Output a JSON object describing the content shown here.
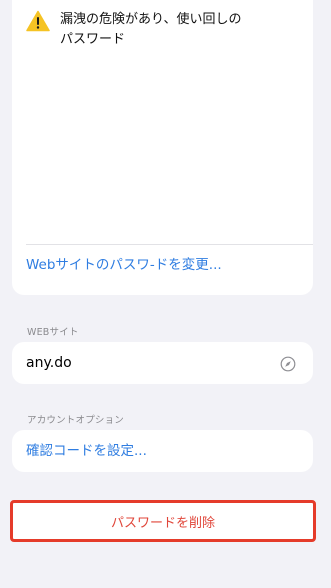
{
  "warning": {
    "line1": "漏洩の危険があり、使い回しの",
    "line2": "パスワード",
    "icon": "warning-triangle-icon",
    "icon_color": "#f5c324"
  },
  "change_password_link": "Webサイトのパスワ-ドを変更...",
  "website": {
    "header": "WEBサイト",
    "value": "any.do",
    "icon": "compass-icon"
  },
  "account_options": {
    "header": "アカウントオプション",
    "set_code_label": "確認コードを設定..."
  },
  "delete_button": {
    "label": "パスワードを削除",
    "highlight_color": "#e53b2a"
  },
  "colors": {
    "link": "#2f7de1",
    "destructive": "#e0463a",
    "background": "#f2f2f7"
  }
}
